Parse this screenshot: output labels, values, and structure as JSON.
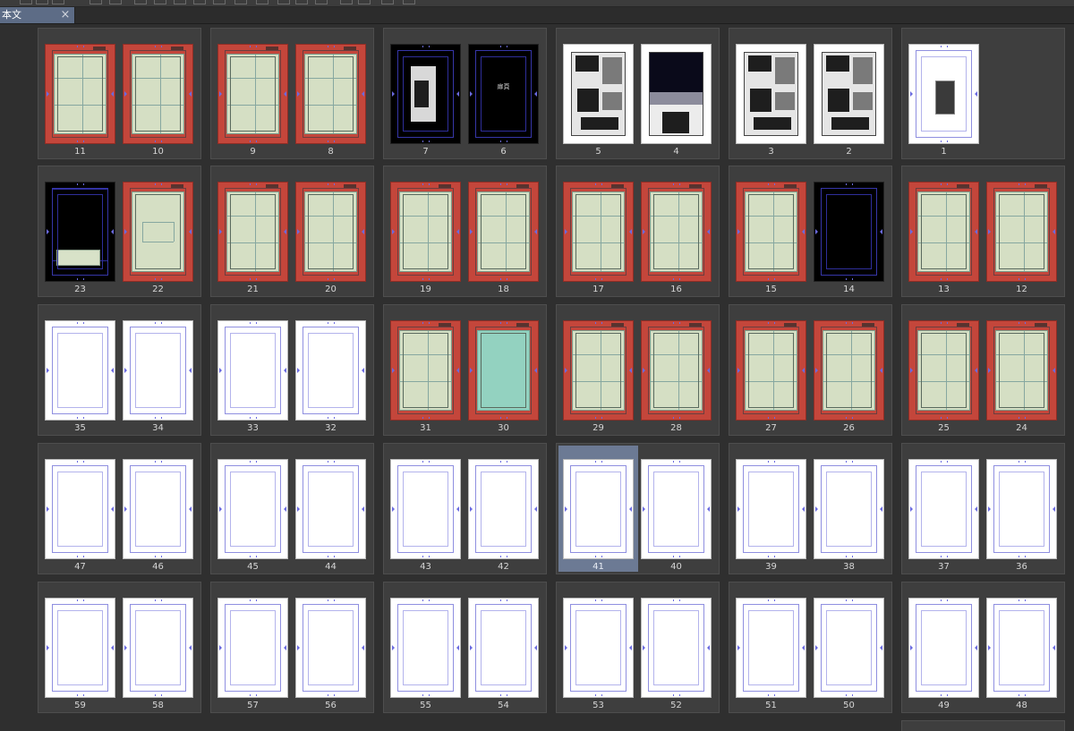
{
  "document_tab": {
    "title": "本文",
    "close": "×"
  },
  "cover_text": "扉頁",
  "rows": [
    {
      "spreads": [
        {
          "pages": [
            {
              "number": "11",
              "kind": "draft"
            },
            {
              "number": "10",
              "kind": "draft"
            }
          ]
        },
        {
          "pages": [
            {
              "number": "9",
              "kind": "draft"
            },
            {
              "number": "8",
              "kind": "draft"
            }
          ]
        },
        {
          "pages": [
            {
              "number": "7",
              "kind": "black-image"
            },
            {
              "number": "6",
              "kind": "black-title"
            }
          ]
        },
        {
          "pages": [
            {
              "number": "5",
              "kind": "manga"
            },
            {
              "number": "4",
              "kind": "manga-night"
            }
          ]
        },
        {
          "pages": [
            {
              "number": "3",
              "kind": "manga"
            },
            {
              "number": "2",
              "kind": "manga"
            }
          ]
        },
        {
          "pages": [
            {
              "number": "1",
              "kind": "cover-small"
            }
          ]
        }
      ]
    },
    {
      "spreads": [
        {
          "pages": [
            {
              "number": "23",
              "kind": "black-block"
            },
            {
              "number": "22",
              "kind": "draft-box"
            }
          ]
        },
        {
          "pages": [
            {
              "number": "21",
              "kind": "draft"
            },
            {
              "number": "20",
              "kind": "draft"
            }
          ]
        },
        {
          "pages": [
            {
              "number": "19",
              "kind": "draft"
            },
            {
              "number": "18",
              "kind": "draft"
            }
          ]
        },
        {
          "pages": [
            {
              "number": "17",
              "kind": "draft"
            },
            {
              "number": "16",
              "kind": "draft"
            }
          ]
        },
        {
          "pages": [
            {
              "number": "15",
              "kind": "draft"
            },
            {
              "number": "14",
              "kind": "black"
            }
          ]
        },
        {
          "pages": [
            {
              "number": "13",
              "kind": "draft"
            },
            {
              "number": "12",
              "kind": "draft"
            }
          ]
        }
      ]
    },
    {
      "spreads": [
        {
          "pages": [
            {
              "number": "35",
              "kind": "blank"
            },
            {
              "number": "34",
              "kind": "blank"
            }
          ]
        },
        {
          "pages": [
            {
              "number": "33",
              "kind": "blank"
            },
            {
              "number": "32",
              "kind": "blank"
            }
          ]
        },
        {
          "pages": [
            {
              "number": "31",
              "kind": "draft"
            },
            {
              "number": "30",
              "kind": "teal"
            }
          ]
        },
        {
          "pages": [
            {
              "number": "29",
              "kind": "draft"
            },
            {
              "number": "28",
              "kind": "draft"
            }
          ]
        },
        {
          "pages": [
            {
              "number": "27",
              "kind": "draft"
            },
            {
              "number": "26",
              "kind": "draft"
            }
          ]
        },
        {
          "pages": [
            {
              "number": "25",
              "kind": "draft"
            },
            {
              "number": "24",
              "kind": "draft"
            }
          ]
        }
      ]
    },
    {
      "spreads": [
        {
          "pages": [
            {
              "number": "47",
              "kind": "blank"
            },
            {
              "number": "46",
              "kind": "blank"
            }
          ]
        },
        {
          "pages": [
            {
              "number": "45",
              "kind": "blank"
            },
            {
              "number": "44",
              "kind": "blank"
            }
          ]
        },
        {
          "pages": [
            {
              "number": "43",
              "kind": "blank"
            },
            {
              "number": "42",
              "kind": "blank"
            }
          ]
        },
        {
          "pages": [
            {
              "number": "41",
              "kind": "blank",
              "selected": true
            },
            {
              "number": "40",
              "kind": "blank"
            }
          ]
        },
        {
          "pages": [
            {
              "number": "39",
              "kind": "blank"
            },
            {
              "number": "38",
              "kind": "blank"
            }
          ]
        },
        {
          "pages": [
            {
              "number": "37",
              "kind": "blank"
            },
            {
              "number": "36",
              "kind": "blank"
            }
          ]
        }
      ]
    },
    {
      "spreads": [
        {
          "pages": [
            {
              "number": "59",
              "kind": "blank"
            },
            {
              "number": "58",
              "kind": "blank"
            }
          ]
        },
        {
          "pages": [
            {
              "number": "57",
              "kind": "blank"
            },
            {
              "number": "56",
              "kind": "blank"
            }
          ]
        },
        {
          "pages": [
            {
              "number": "55",
              "kind": "blank"
            },
            {
              "number": "54",
              "kind": "blank"
            }
          ]
        },
        {
          "pages": [
            {
              "number": "53",
              "kind": "blank"
            },
            {
              "number": "52",
              "kind": "blank"
            }
          ]
        },
        {
          "pages": [
            {
              "number": "51",
              "kind": "blank"
            },
            {
              "number": "50",
              "kind": "blank"
            }
          ]
        },
        {
          "pages": [
            {
              "number": "49",
              "kind": "blank"
            },
            {
              "number": "48",
              "kind": "blank"
            }
          ]
        }
      ]
    }
  ],
  "colors": {
    "draft_red": "#c4463b",
    "draft_green": "#d5dfc4",
    "teal": "#93d2c0",
    "selection": "#6c7a94",
    "guide_blue": "#8f8fe0"
  }
}
